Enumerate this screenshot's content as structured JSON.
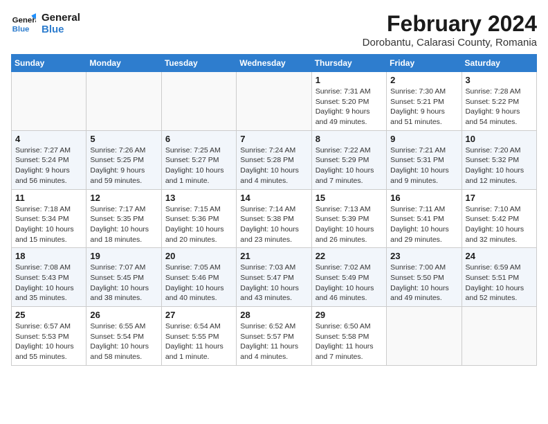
{
  "header": {
    "logo_line1": "General",
    "logo_line2": "Blue",
    "month_year": "February 2024",
    "subtitle": "Dorobantu, Calarasi County, Romania"
  },
  "weekdays": [
    "Sunday",
    "Monday",
    "Tuesday",
    "Wednesday",
    "Thursday",
    "Friday",
    "Saturday"
  ],
  "weeks": [
    [
      {
        "day": "",
        "detail": ""
      },
      {
        "day": "",
        "detail": ""
      },
      {
        "day": "",
        "detail": ""
      },
      {
        "day": "",
        "detail": ""
      },
      {
        "day": "1",
        "detail": "Sunrise: 7:31 AM\nSunset: 5:20 PM\nDaylight: 9 hours\nand 49 minutes."
      },
      {
        "day": "2",
        "detail": "Sunrise: 7:30 AM\nSunset: 5:21 PM\nDaylight: 9 hours\nand 51 minutes."
      },
      {
        "day": "3",
        "detail": "Sunrise: 7:28 AM\nSunset: 5:22 PM\nDaylight: 9 hours\nand 54 minutes."
      }
    ],
    [
      {
        "day": "4",
        "detail": "Sunrise: 7:27 AM\nSunset: 5:24 PM\nDaylight: 9 hours\nand 56 minutes."
      },
      {
        "day": "5",
        "detail": "Sunrise: 7:26 AM\nSunset: 5:25 PM\nDaylight: 9 hours\nand 59 minutes."
      },
      {
        "day": "6",
        "detail": "Sunrise: 7:25 AM\nSunset: 5:27 PM\nDaylight: 10 hours\nand 1 minute."
      },
      {
        "day": "7",
        "detail": "Sunrise: 7:24 AM\nSunset: 5:28 PM\nDaylight: 10 hours\nand 4 minutes."
      },
      {
        "day": "8",
        "detail": "Sunrise: 7:22 AM\nSunset: 5:29 PM\nDaylight: 10 hours\nand 7 minutes."
      },
      {
        "day": "9",
        "detail": "Sunrise: 7:21 AM\nSunset: 5:31 PM\nDaylight: 10 hours\nand 9 minutes."
      },
      {
        "day": "10",
        "detail": "Sunrise: 7:20 AM\nSunset: 5:32 PM\nDaylight: 10 hours\nand 12 minutes."
      }
    ],
    [
      {
        "day": "11",
        "detail": "Sunrise: 7:18 AM\nSunset: 5:34 PM\nDaylight: 10 hours\nand 15 minutes."
      },
      {
        "day": "12",
        "detail": "Sunrise: 7:17 AM\nSunset: 5:35 PM\nDaylight: 10 hours\nand 18 minutes."
      },
      {
        "day": "13",
        "detail": "Sunrise: 7:15 AM\nSunset: 5:36 PM\nDaylight: 10 hours\nand 20 minutes."
      },
      {
        "day": "14",
        "detail": "Sunrise: 7:14 AM\nSunset: 5:38 PM\nDaylight: 10 hours\nand 23 minutes."
      },
      {
        "day": "15",
        "detail": "Sunrise: 7:13 AM\nSunset: 5:39 PM\nDaylight: 10 hours\nand 26 minutes."
      },
      {
        "day": "16",
        "detail": "Sunrise: 7:11 AM\nSunset: 5:41 PM\nDaylight: 10 hours\nand 29 minutes."
      },
      {
        "day": "17",
        "detail": "Sunrise: 7:10 AM\nSunset: 5:42 PM\nDaylight: 10 hours\nand 32 minutes."
      }
    ],
    [
      {
        "day": "18",
        "detail": "Sunrise: 7:08 AM\nSunset: 5:43 PM\nDaylight: 10 hours\nand 35 minutes."
      },
      {
        "day": "19",
        "detail": "Sunrise: 7:07 AM\nSunset: 5:45 PM\nDaylight: 10 hours\nand 38 minutes."
      },
      {
        "day": "20",
        "detail": "Sunrise: 7:05 AM\nSunset: 5:46 PM\nDaylight: 10 hours\nand 40 minutes."
      },
      {
        "day": "21",
        "detail": "Sunrise: 7:03 AM\nSunset: 5:47 PM\nDaylight: 10 hours\nand 43 minutes."
      },
      {
        "day": "22",
        "detail": "Sunrise: 7:02 AM\nSunset: 5:49 PM\nDaylight: 10 hours\nand 46 minutes."
      },
      {
        "day": "23",
        "detail": "Sunrise: 7:00 AM\nSunset: 5:50 PM\nDaylight: 10 hours\nand 49 minutes."
      },
      {
        "day": "24",
        "detail": "Sunrise: 6:59 AM\nSunset: 5:51 PM\nDaylight: 10 hours\nand 52 minutes."
      }
    ],
    [
      {
        "day": "25",
        "detail": "Sunrise: 6:57 AM\nSunset: 5:53 PM\nDaylight: 10 hours\nand 55 minutes."
      },
      {
        "day": "26",
        "detail": "Sunrise: 6:55 AM\nSunset: 5:54 PM\nDaylight: 10 hours\nand 58 minutes."
      },
      {
        "day": "27",
        "detail": "Sunrise: 6:54 AM\nSunset: 5:55 PM\nDaylight: 11 hours\nand 1 minute."
      },
      {
        "day": "28",
        "detail": "Sunrise: 6:52 AM\nSunset: 5:57 PM\nDaylight: 11 hours\nand 4 minutes."
      },
      {
        "day": "29",
        "detail": "Sunrise: 6:50 AM\nSunset: 5:58 PM\nDaylight: 11 hours\nand 7 minutes."
      },
      {
        "day": "",
        "detail": ""
      },
      {
        "day": "",
        "detail": ""
      }
    ]
  ]
}
